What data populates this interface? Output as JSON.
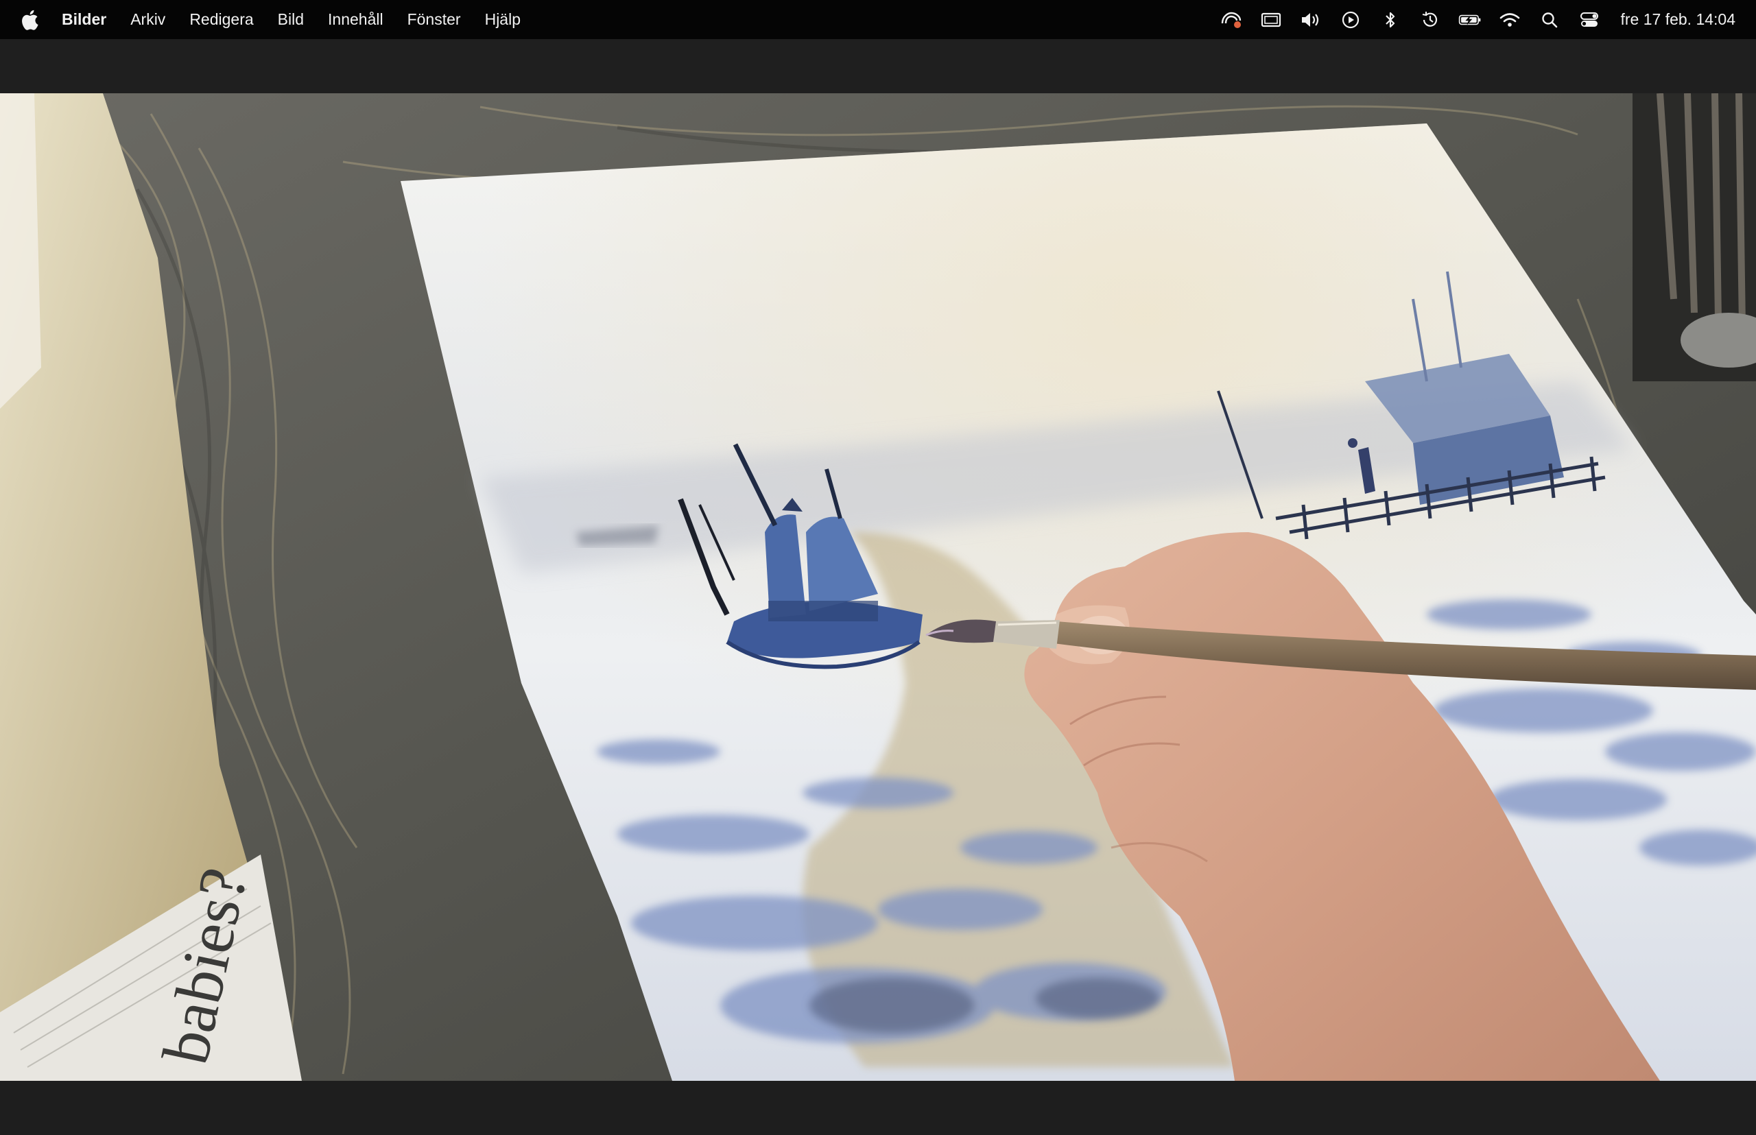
{
  "menubar": {
    "app_name": "Bilder",
    "items": [
      {
        "label": "Arkiv"
      },
      {
        "label": "Redigera"
      },
      {
        "label": "Bild"
      },
      {
        "label": "Innehåll"
      },
      {
        "label": "Fönster"
      },
      {
        "label": "Hjälp"
      }
    ],
    "status_icons": [
      "screen-recording-icon",
      "display-icon",
      "volume-icon",
      "now-playing-icon",
      "bluetooth-icon",
      "time-machine-icon",
      "battery-charging-icon",
      "wifi-icon",
      "spotlight-search-icon",
      "control-center-icon"
    ],
    "clock": "fre 17 feb.  14:04"
  },
  "photo": {
    "subject": "hand painting watercolor harbor scene with boat and pier on wooden drawing board",
    "newspaper_text": "babies?"
  },
  "colors": {
    "menubar_bg": "#050505",
    "window_bg": "#1e1e1e",
    "menu_text": "#f2f2f2"
  }
}
